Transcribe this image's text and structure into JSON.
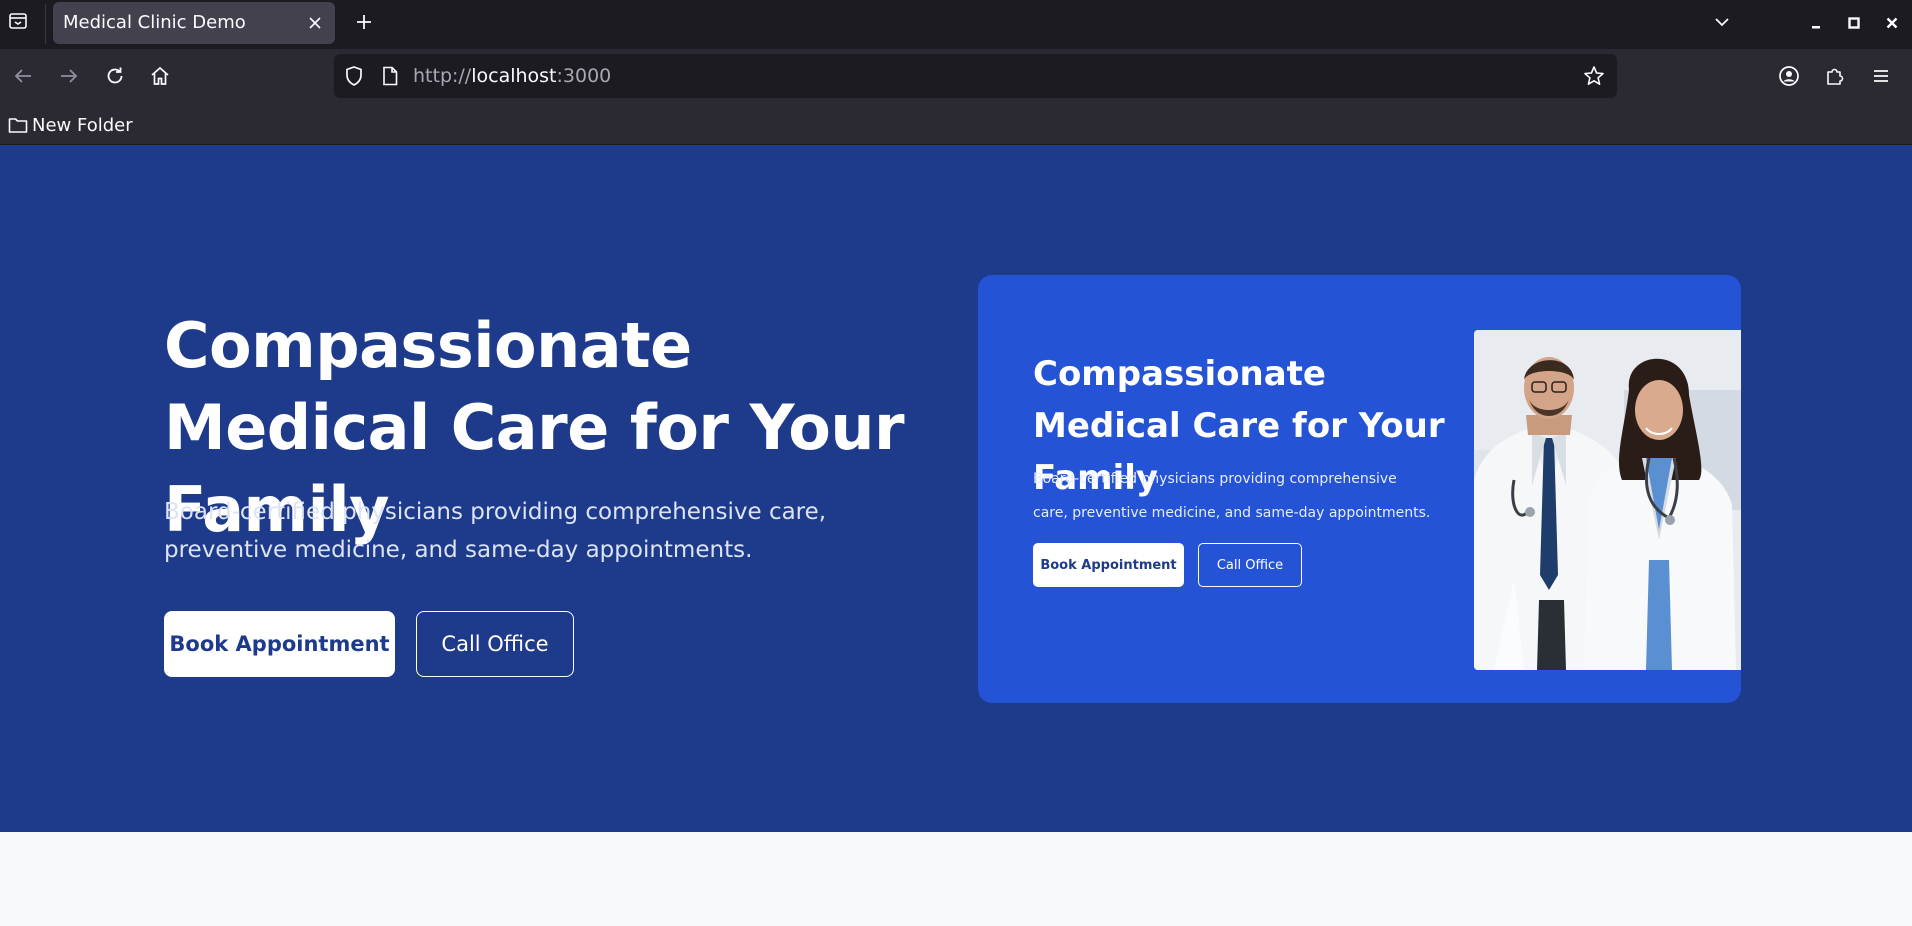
{
  "browser": {
    "tab_title": "Medical Clinic Demo",
    "url_scheme": "http://",
    "url_host": "localhost",
    "url_port": ":3000",
    "bookmark_folder": "New Folder",
    "icons": [
      "tab-list-icon",
      "close-icon",
      "plus-icon",
      "chevron-down-icon",
      "minimize-icon",
      "maximize-icon",
      "window-close-icon",
      "back-arrow-icon",
      "forward-arrow-icon",
      "reload-icon",
      "home-icon",
      "shield-icon",
      "page-icon",
      "star-icon",
      "account-icon",
      "extensions-icon",
      "menu-icon",
      "folder-icon"
    ]
  },
  "hero": {
    "title": "Compassionate Medical Care for Your Family",
    "description": "Board-certified physicians providing comprehensive care, preventive medicine, and same-day appointments.",
    "primary_cta": "Book Appointment",
    "secondary_cta": "Call Office"
  },
  "preview": {
    "title": "Compassionate Medical Care for Your Family",
    "description": "Board-certified physicians providing comprehensive care, preventive medicine, and same-day appointments.",
    "primary_cta": "Book Appointment",
    "secondary_cta": "Call Office",
    "photo": "doctors-photo"
  },
  "colors": {
    "hero_bg": "#1e3a8a",
    "card_bg": "#2453d6",
    "chrome_dark": "#1c1b22",
    "chrome_mid": "#2b2a33"
  }
}
